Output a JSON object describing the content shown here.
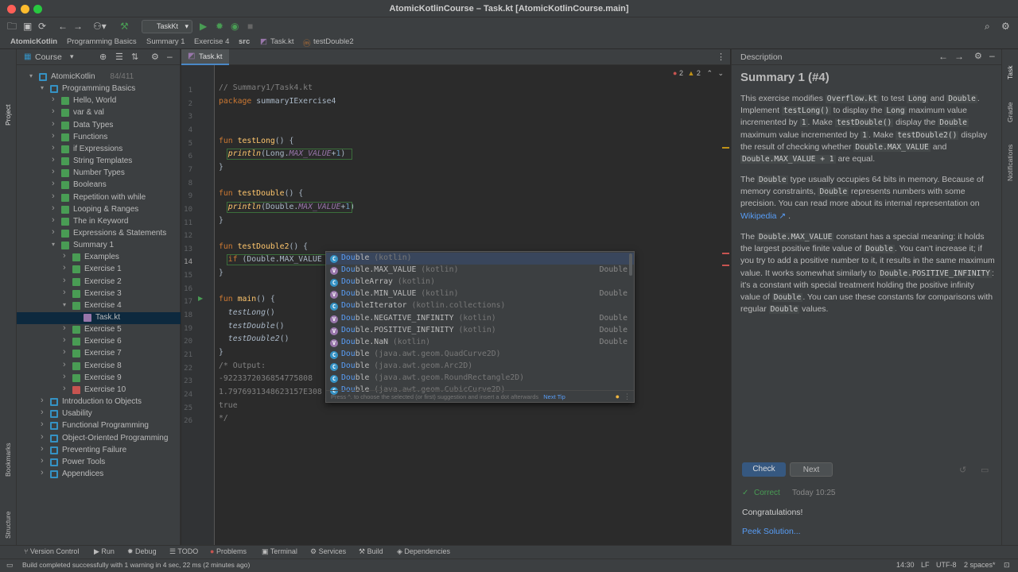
{
  "window": {
    "title": "AtomicKotlinCourse – Task.kt [AtomicKotlinCourse.main]"
  },
  "toolbar": {
    "run_config": "TaskKt"
  },
  "breadcrumbs": [
    "AtomicKotlin",
    "Programming Basics",
    "Summary 1",
    "Exercise 4",
    "src",
    "Task.kt",
    "testDouble2"
  ],
  "left_stripe": {
    "project": "Project",
    "bookmarks": "Bookmarks",
    "structure": "Structure"
  },
  "project": {
    "title": "Course",
    "tree": [
      {
        "label": "AtomicKotlin",
        "extra": "84/411",
        "depth": 0,
        "open": true,
        "icon": "course"
      },
      {
        "label": "Programming Basics",
        "depth": 1,
        "open": true,
        "icon": "section"
      },
      {
        "label": "Hello, World",
        "depth": 2,
        "icon": "lesson"
      },
      {
        "label": "var & val",
        "depth": 2,
        "icon": "lesson"
      },
      {
        "label": "Data Types",
        "depth": 2,
        "icon": "lesson"
      },
      {
        "label": "Functions",
        "depth": 2,
        "icon": "lesson"
      },
      {
        "label": "if Expressions",
        "depth": 2,
        "icon": "lesson"
      },
      {
        "label": "String Templates",
        "depth": 2,
        "icon": "lesson"
      },
      {
        "label": "Number Types",
        "depth": 2,
        "icon": "lesson"
      },
      {
        "label": "Booleans",
        "depth": 2,
        "icon": "lesson"
      },
      {
        "label": "Repetition with while",
        "depth": 2,
        "icon": "lesson"
      },
      {
        "label": "Looping & Ranges",
        "depth": 2,
        "icon": "lesson"
      },
      {
        "label": "The in Keyword",
        "depth": 2,
        "icon": "lesson"
      },
      {
        "label": "Expressions & Statements",
        "depth": 2,
        "icon": "lesson"
      },
      {
        "label": "Summary 1",
        "depth": 2,
        "open": true,
        "icon": "lesson"
      },
      {
        "label": "Examples",
        "depth": 3,
        "icon": "task"
      },
      {
        "label": "Exercise 1",
        "depth": 3,
        "icon": "task"
      },
      {
        "label": "Exercise 2",
        "depth": 3,
        "icon": "task"
      },
      {
        "label": "Exercise 3",
        "depth": 3,
        "icon": "task"
      },
      {
        "label": "Exercise 4",
        "depth": 3,
        "open": true,
        "icon": "task"
      },
      {
        "label": "Task.kt",
        "depth": 4,
        "icon": "file",
        "selected": true
      },
      {
        "label": "Exercise 5",
        "depth": 3,
        "icon": "task"
      },
      {
        "label": "Exercise 6",
        "depth": 3,
        "icon": "task"
      },
      {
        "label": "Exercise 7",
        "depth": 3,
        "icon": "task"
      },
      {
        "label": "Exercise 8",
        "depth": 3,
        "icon": "task"
      },
      {
        "label": "Exercise 9",
        "depth": 3,
        "icon": "task"
      },
      {
        "label": "Exercise 10",
        "depth": 3,
        "icon": "task-failed"
      },
      {
        "label": "Introduction to Objects",
        "depth": 1,
        "icon": "section"
      },
      {
        "label": "Usability",
        "depth": 1,
        "icon": "section"
      },
      {
        "label": "Functional Programming",
        "depth": 1,
        "icon": "section"
      },
      {
        "label": "Object-Oriented Programming",
        "depth": 1,
        "icon": "section"
      },
      {
        "label": "Preventing Failure",
        "depth": 1,
        "icon": "section"
      },
      {
        "label": "Power Tools",
        "depth": 1,
        "icon": "section"
      },
      {
        "label": "Appendices",
        "depth": 1,
        "icon": "section"
      }
    ]
  },
  "editor": {
    "tab": "Task.kt",
    "errors": "2",
    "warnings": "2",
    "current_line": 14,
    "lines": [
      [
        {
          "t": "// Summary1/Task4.kt",
          "c": "cm"
        }
      ],
      [
        {
          "t": "package ",
          "c": "kw"
        },
        {
          "t": "summaryIExercise4",
          "c": ""
        }
      ],
      [],
      [],
      [
        {
          "t": "fun ",
          "c": "kw"
        },
        {
          "t": "testLong",
          "c": "fn"
        },
        {
          "t": "() {",
          "c": ""
        }
      ],
      [
        {
          "t": "  ",
          "c": ""
        },
        {
          "t": "println",
          "c": "fn it"
        },
        {
          "t": "(Long.",
          "c": ""
        },
        {
          "t": "MAX_VALUE",
          "c": "pu it"
        },
        {
          "t": "+",
          "c": ""
        },
        {
          "t": "1",
          "c": "nm"
        },
        {
          "t": ")",
          "c": ""
        }
      ],
      [
        {
          "t": "}",
          "c": ""
        }
      ],
      [],
      [
        {
          "t": "fun ",
          "c": "kw"
        },
        {
          "t": "testDouble",
          "c": "fn"
        },
        {
          "t": "() {",
          "c": ""
        }
      ],
      [
        {
          "t": "  ",
          "c": ""
        },
        {
          "t": "println",
          "c": "fn it"
        },
        {
          "t": "(Double.",
          "c": ""
        },
        {
          "t": "MAX_VALUE",
          "c": "pu it"
        },
        {
          "t": "+",
          "c": ""
        },
        {
          "t": "1",
          "c": "nm"
        },
        {
          "t": ")",
          "c": ""
        }
      ],
      [
        {
          "t": "}",
          "c": ""
        }
      ],
      [],
      [
        {
          "t": "fun ",
          "c": "kw"
        },
        {
          "t": "testDouble2",
          "c": "fn"
        },
        {
          "t": "() {",
          "c": ""
        }
      ],
      [
        {
          "t": "  ",
          "c": ""
        },
        {
          "t": "if ",
          "c": "kw"
        },
        {
          "t": "(Double.MAX_VALUE == Dou",
          "c": ""
        }
      ],
      [
        {
          "t": "}",
          "c": ""
        }
      ],
      [],
      [
        {
          "t": "fun ",
          "c": "kw"
        },
        {
          "t": "main",
          "c": "fn"
        },
        {
          "t": "() {",
          "c": ""
        }
      ],
      [
        {
          "t": "  ",
          "c": ""
        },
        {
          "t": "testLong",
          "c": "it"
        },
        {
          "t": "()",
          "c": ""
        }
      ],
      [
        {
          "t": "  ",
          "c": ""
        },
        {
          "t": "testDouble",
          "c": "it"
        },
        {
          "t": "()",
          "c": ""
        }
      ],
      [
        {
          "t": "  ",
          "c": ""
        },
        {
          "t": "testDouble2",
          "c": "it"
        },
        {
          "t": "()",
          "c": ""
        }
      ],
      [
        {
          "t": "}",
          "c": ""
        }
      ],
      [
        {
          "t": "/* Output:",
          "c": "cm"
        }
      ],
      [
        {
          "t": "-9223372036854775808",
          "c": "cm"
        }
      ],
      [
        {
          "t": "1.7976931348623157E308",
          "c": "cm"
        }
      ],
      [
        {
          "t": "true",
          "c": "cm"
        }
      ],
      [
        {
          "t": "*/",
          "c": "cm"
        }
      ]
    ]
  },
  "completion": {
    "prefix": "Dou",
    "items": [
      {
        "icon": "class",
        "name": "Double",
        "context": "(kotlin)",
        "type": ""
      },
      {
        "icon": "val",
        "name": "Double.MAX_VALUE",
        "context": "(kotlin)",
        "type": "Double"
      },
      {
        "icon": "class",
        "name": "DoubleArray",
        "context": "(kotlin)",
        "type": ""
      },
      {
        "icon": "val",
        "name": "Double.MIN_VALUE",
        "context": "(kotlin)",
        "type": "Double"
      },
      {
        "icon": "class",
        "name": "DoubleIterator",
        "context": "(kotlin.collections)",
        "type": ""
      },
      {
        "icon": "val",
        "name": "Double.NEGATIVE_INFINITY",
        "context": "(kotlin)",
        "type": "Double"
      },
      {
        "icon": "val",
        "name": "Double.POSITIVE_INFINITY",
        "context": "(kotlin)",
        "type": "Double"
      },
      {
        "icon": "val",
        "name": "Double.NaN",
        "context": "(kotlin)",
        "type": "Double"
      },
      {
        "icon": "jclass",
        "name": "Double",
        "context": "(java.awt.geom.QuadCurve2D)",
        "type": ""
      },
      {
        "icon": "jclass",
        "name": "Double",
        "context": "(java.awt.geom.Arc2D)",
        "type": ""
      },
      {
        "icon": "jclass",
        "name": "Double",
        "context": "(java.awt.geom.RoundRectangle2D)",
        "type": ""
      },
      {
        "icon": "jclass",
        "name": "Double",
        "context": "(java.awt.geom.CubicCurve2D)",
        "type": ""
      }
    ],
    "footer": "Press ^. to choose the selected (or first) suggestion and insert a dot afterwards",
    "next_tip": "Next Tip"
  },
  "description": {
    "panel_title": "Description",
    "heading": "Summary 1 (#4)",
    "p1": [
      {
        "t": "This exercise modifies ",
        "code": false
      },
      {
        "t": "Overflow.kt",
        "code": true
      },
      {
        "t": " to test ",
        "code": false
      },
      {
        "t": "Long",
        "code": true
      },
      {
        "t": " and ",
        "code": false
      },
      {
        "t": "Double",
        "code": true
      },
      {
        "t": ". Implement ",
        "code": false
      },
      {
        "t": "testLong()",
        "code": true
      },
      {
        "t": " to display the ",
        "code": false
      },
      {
        "t": "Long",
        "code": true
      },
      {
        "t": " maximum value incremented by ",
        "code": false
      },
      {
        "t": "1",
        "code": true
      },
      {
        "t": ". Make ",
        "code": false
      },
      {
        "t": "testDouble()",
        "code": true
      },
      {
        "t": " display the ",
        "code": false
      },
      {
        "t": "Double",
        "code": true
      },
      {
        "t": " maximum value incremented by ",
        "code": false
      },
      {
        "t": "1",
        "code": true
      },
      {
        "t": ". Make ",
        "code": false
      },
      {
        "t": "testDouble2()",
        "code": true
      },
      {
        "t": " display the result of checking whether ",
        "code": false
      },
      {
        "t": "Double.MAX_VALUE",
        "code": true
      },
      {
        "t": " and ",
        "code": false
      },
      {
        "t": "Double.MAX_VALUE + 1",
        "code": true
      },
      {
        "t": " are equal.",
        "code": false
      }
    ],
    "p2": [
      {
        "t": "The ",
        "code": false
      },
      {
        "t": "Double",
        "code": true
      },
      {
        "t": " type usually occupies 64 bits in memory. Because of memory constraints, ",
        "code": false
      },
      {
        "t": "Double",
        "code": true
      },
      {
        "t": " represents numbers with some precision. You can read more about its internal representation on ",
        "code": false
      },
      {
        "t": "Wikipedia ↗",
        "link": true
      },
      {
        "t": " .",
        "code": false
      }
    ],
    "p3": [
      {
        "t": "The ",
        "code": false
      },
      {
        "t": "Double.MAX_VALUE",
        "code": true
      },
      {
        "t": " constant has a special meaning: it holds the largest positive finite value of ",
        "code": false
      },
      {
        "t": "Double",
        "code": true
      },
      {
        "t": ". You can't increase it; if you try to add a positive number to it, it results in the same maximum value. It works somewhat similarly to ",
        "code": false
      },
      {
        "t": "Double.POSITIVE_INFINITY",
        "code": true
      },
      {
        "t": ": it's a constant with special treatment holding the positive infinity value of ",
        "code": false
      },
      {
        "t": "Double",
        "code": true
      },
      {
        "t": ". You can use these constants for comparisons with regular ",
        "code": false
      },
      {
        "t": "Double",
        "code": true
      },
      {
        "t": " values.",
        "code": false
      }
    ],
    "check_label": "Check",
    "next_label": "Next",
    "status": "Correct",
    "time": "Today 10:25",
    "message": "Congratulations!",
    "peek": "Peek Solution..."
  },
  "right_stripe": {
    "task": "Task",
    "gradle": "Gradle",
    "notifications": "Notifications"
  },
  "bottom_tools": [
    "Version Control",
    "Run",
    "Debug",
    "TODO",
    "Problems",
    "Terminal",
    "Services",
    "Build",
    "Dependencies"
  ],
  "status": {
    "message": "Build completed successfully with 1 warning in 4 sec, 22 ms (2 minutes ago)",
    "position": "14:30",
    "line_sep": "LF",
    "encoding": "UTF-8",
    "indent": "2 spaces*"
  },
  "colors": {
    "accent": "#589df6",
    "success": "#499c54",
    "error": "#c75450",
    "keyword": "#cc7832",
    "function": "#ffc66d"
  }
}
